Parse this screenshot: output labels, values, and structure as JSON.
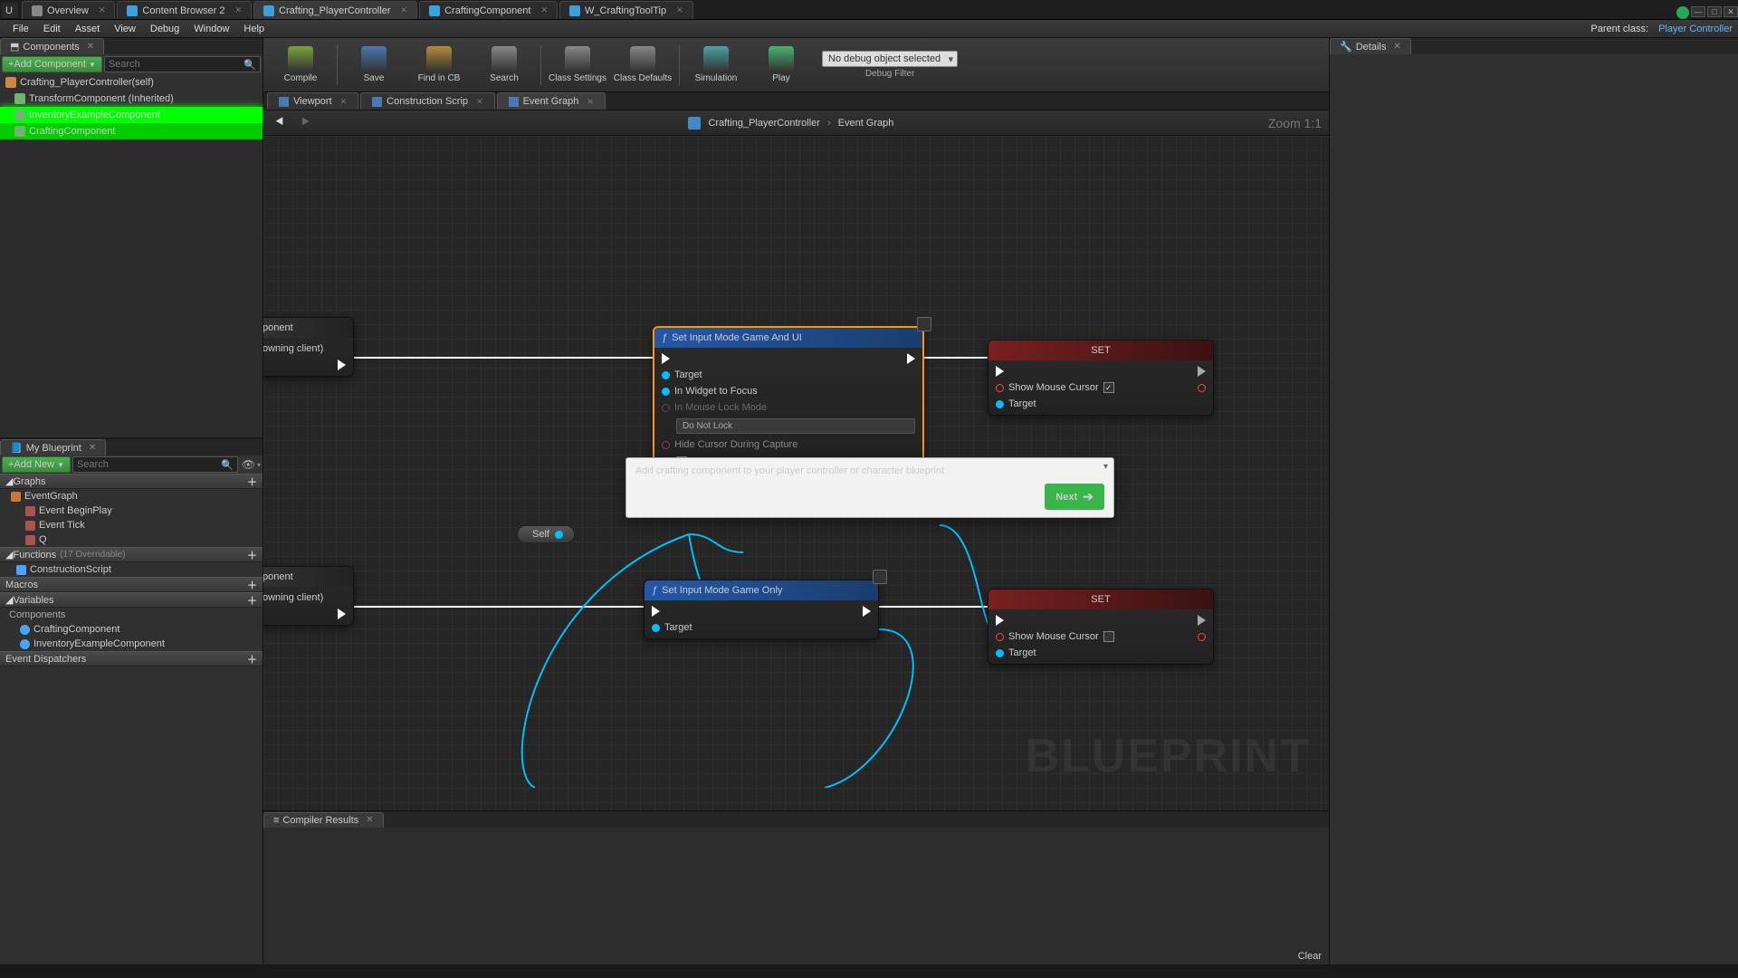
{
  "topTabs": [
    {
      "label": "Overview",
      "color": "#888"
    },
    {
      "label": "Content Browser 2",
      "color": "#3aa0e0"
    },
    {
      "label": "Crafting_PlayerController",
      "color": "#3aa0e0",
      "active": true
    },
    {
      "label": "CraftingComponent",
      "color": "#3aa0e0"
    },
    {
      "label": "W_CraftingToolTip",
      "color": "#3aa0e0"
    }
  ],
  "menus": [
    "File",
    "Edit",
    "Asset",
    "View",
    "Debug",
    "Window",
    "Help"
  ],
  "parentClass": {
    "label": "Parent class:",
    "value": "Player Controller"
  },
  "componentsPanel": {
    "title": "Components",
    "addBtn": "+Add Component",
    "searchPlaceholder": "Search",
    "root": "Crafting_PlayerController(self)",
    "items": [
      {
        "label": "TransformComponent (Inherited)",
        "color": "#6fb56f"
      },
      {
        "label": "InventoryExampleComponent",
        "color": "#6fb56f",
        "hl": true
      },
      {
        "label": "CraftingComponent",
        "color": "#6fb56f",
        "hl2": true
      }
    ]
  },
  "myBlueprint": {
    "title": "My Blueprint",
    "addBtn": "+Add New",
    "searchPlaceholder": "Search",
    "sections": {
      "graphs": {
        "title": "Graphs",
        "items": [
          "EventGraph",
          "Event BeginPlay",
          "Event Tick",
          "Q"
        ]
      },
      "functions": {
        "title": "Functions",
        "dim": "(17 Overridable)",
        "items": [
          "ConstructionScript"
        ]
      },
      "macros": {
        "title": "Macros",
        "items": []
      },
      "variables": {
        "title": "Variables",
        "sub": "Components",
        "items": [
          {
            "label": "CraftingComponent",
            "color": "#4aa3ff"
          },
          {
            "label": "InventoryExampleComponent",
            "color": "#4aa3ff"
          }
        ]
      },
      "dispatchers": {
        "title": "Event Dispatchers",
        "items": []
      }
    }
  },
  "toolbar": [
    {
      "label": "Compile",
      "color": "#7aa33a"
    },
    {
      "label": "Save",
      "color": "#4a78b5"
    },
    {
      "label": "Find in CB",
      "color": "#b58a3a"
    },
    {
      "label": "Search",
      "color": "#888"
    },
    {
      "label": "Class Settings",
      "color": "#888"
    },
    {
      "label": "Class Defaults",
      "color": "#888"
    },
    {
      "label": "Simulation",
      "color": "#4aa3a3"
    },
    {
      "label": "Play",
      "color": "#4ab56f"
    }
  ],
  "debug": {
    "combo": "No debug object selected",
    "label": "Debug Filter"
  },
  "subtabs": [
    {
      "label": "Viewport"
    },
    {
      "label": "Construction Scrip"
    },
    {
      "label": "Event Graph",
      "active": true
    }
  ],
  "breadcrumb": {
    "a": "Crafting_PlayerController",
    "b": "Event Graph"
  },
  "zoom": "Zoom 1:1",
  "watermark": "BLUEPRINT",
  "nodes": {
    "evt1": {
      "sub": "ponent",
      "sub2": "owning client)"
    },
    "setinput1": {
      "title": "Set Input Mode Game And UI",
      "pins": [
        "Target",
        "In Widget to Focus",
        "In Mouse Lock Mode",
        "Hide Cursor During Capture"
      ],
      "dropdown": "Do Not Lock"
    },
    "set1": {
      "title": "SET",
      "pin": "Show Mouse Cursor",
      "pin2": "Target",
      "checked": true
    },
    "evt2": {
      "sub": "ponent",
      "sub2": "owning client)"
    },
    "setinput2": {
      "title": "Set Input Mode Game Only",
      "pins": [
        "Target"
      ]
    },
    "set2": {
      "title": "SET",
      "pin": "Show Mouse Cursor",
      "pin2": "Target",
      "checked": false
    },
    "self": "Self"
  },
  "popup": {
    "text": "Add crafting component to your player controller or character blueprint",
    "btn": "Next"
  },
  "compiler": {
    "title": "Compiler Results",
    "clear": "Clear"
  },
  "details": {
    "title": "Details"
  }
}
